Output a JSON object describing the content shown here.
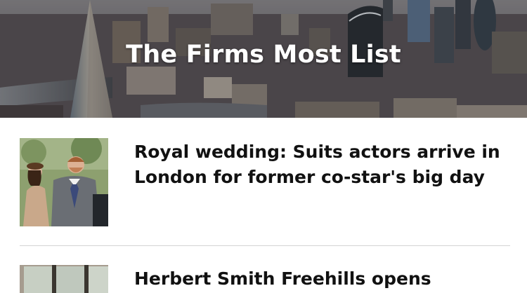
{
  "hero": {
    "title": "The Firms Most List",
    "image": "london-skyline-aerial"
  },
  "articles": [
    {
      "headline": "Royal wedding: Suits actors arrive in London for former co-star's big day",
      "thumbnail": "royal-couple-photo"
    },
    {
      "headline": "Herbert Smith Freehills opens",
      "thumbnail": "office-interior-photo"
    }
  ],
  "colors": {
    "title_text": "#ffffff",
    "headline_text": "#111111",
    "divider": "#d4d4d4"
  }
}
